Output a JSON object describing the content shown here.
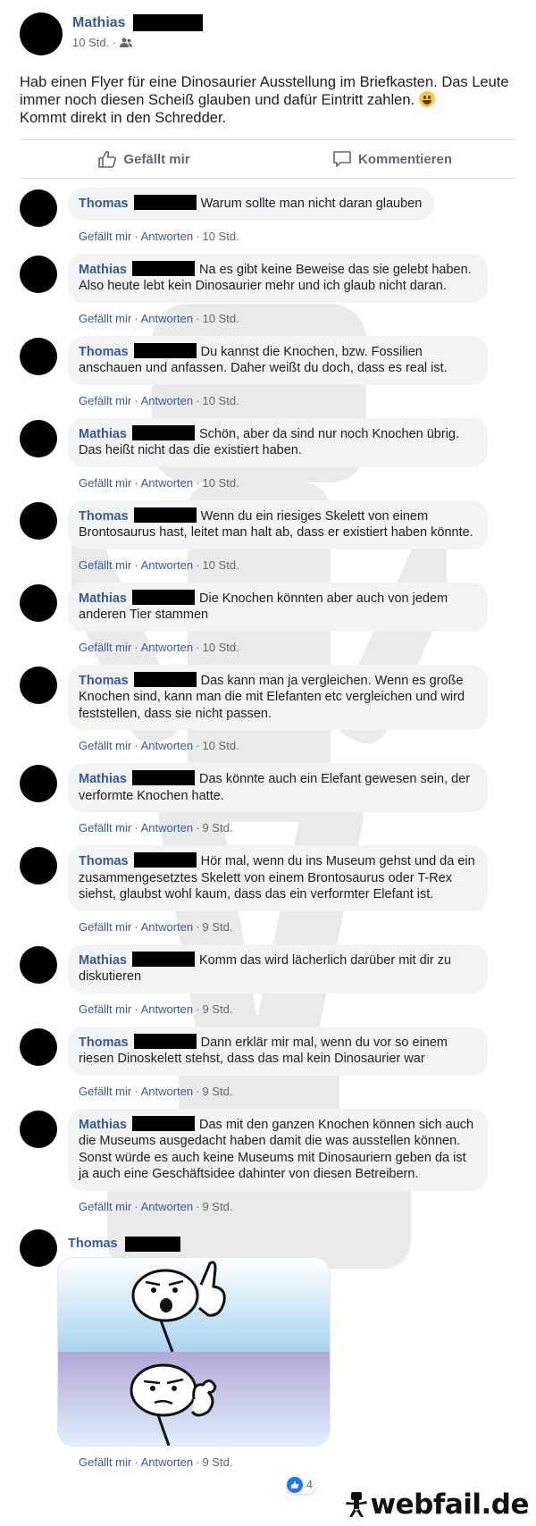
{
  "post": {
    "author": "Mathias",
    "time": "10 Std. ·",
    "text": "Hab einen Flyer für eine Dinosaurier Ausstellung im Briefkasten. Das Leute immer noch diesen Scheiß glauben und dafür Eintritt zahlen.",
    "text_end": "Kommt direkt in den Schredder.",
    "actions": {
      "like": "Gefällt mir",
      "comment": "Kommentieren"
    }
  },
  "comments": [
    {
      "author": "Thomas",
      "text": "Warum sollte man nicht daran glauben",
      "time": "10 Std."
    },
    {
      "author": "Mathias",
      "text": "Na es gibt keine Beweise das sie gelebt haben. Also heute lebt kein Dinosaurier mehr und ich glaub nicht daran.",
      "time": "10 Std."
    },
    {
      "author": "Thomas",
      "text": "Du kannst die Knochen, bzw. Fossilien anschauen und anfassen. Daher weißt du doch, dass es real ist.",
      "time": "10 Std."
    },
    {
      "author": "Mathias",
      "text": "Schön, aber da sind nur noch Knochen übrig. Das heißt nicht das die existiert haben.",
      "time": "10 Std."
    },
    {
      "author": "Thomas",
      "text": "Wenn du ein riesiges Skelett von einem Brontosaurus hast, leitet man halt ab, dass er existiert haben könnte.",
      "time": "10 Std."
    },
    {
      "author": "Mathias",
      "text": "Die Knochen könnten aber auch von jedem anderen Tier stammen",
      "time": "10 Std."
    },
    {
      "author": "Thomas",
      "text": "Das kann man ja vergleichen. Wenn es große Knochen sind, kann man die mit Elefanten etc vergleichen und wird feststellen, dass sie nicht passen.",
      "time": "10 Std."
    },
    {
      "author": "Mathias",
      "text": "Das könnte auch ein Elefant gewesen sein, der verformte Knochen hatte.",
      "time": "9 Std."
    },
    {
      "author": "Thomas",
      "text": "Hör mal, wenn du ins Museum gehst und da ein zusammengesetztes Skelett von einem Brontosaurus oder T-Rex siehst, glaubst wohl kaum, dass das ein verformter Elefant ist.",
      "time": "9 Std."
    },
    {
      "author": "Mathias",
      "text": "Komm das wird lächerlich darüber mit dir zu diskutieren",
      "time": "9 Std."
    },
    {
      "author": "Thomas",
      "text": "Dann erklär mir mal, wenn du vor so einem riesen Dinoskelett stehst, dass das mal kein Dinosaurier war",
      "time": "9 Std."
    },
    {
      "author": "Mathias",
      "text": "Das mit den ganzen Knochen können sich auch die Museums ausgedacht haben damit die was ausstellen können. Sonst würde es auch keine Museums mit Dinosauriern geben da ist ja auch eine Geschäftsidee dahinter von diesen Betreibern.",
      "time": "9 Std."
    }
  ],
  "comment_actions": {
    "like": "Gefällt mir",
    "reply": "Antworten"
  },
  "last_comment": {
    "author": "Thomas",
    "time": "9 Std.",
    "reaction_count": "4"
  },
  "watermark": "webfail.de",
  "colors": {
    "link": "#385898",
    "bubble": "#f2f3f5",
    "meta": "#606770",
    "like_blue": "#1877f2"
  }
}
